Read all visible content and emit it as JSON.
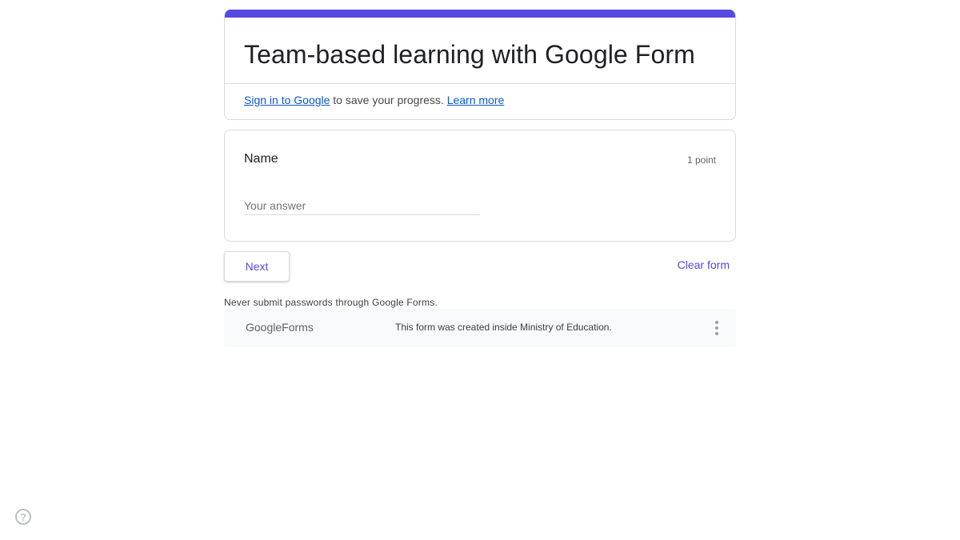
{
  "colors": {
    "accent": "#5748e2",
    "link": "#0b57d0"
  },
  "header": {
    "title": "Team-based learning with Google Form",
    "signin_link": "Sign in to Google",
    "signin_middle": " to save your progress. ",
    "learn_more": "Learn more"
  },
  "question": {
    "title": "Name",
    "points": "1 point",
    "placeholder": "Your answer",
    "value": ""
  },
  "actions": {
    "next_label": "Next",
    "clear_label": "Clear form"
  },
  "warning": "Never submit passwords through Google Forms.",
  "footer": {
    "logo_google": "Google",
    "logo_forms": "Forms",
    "text": "This form was created inside Ministry of Education.",
    "menu_icon": "more-vert-icon"
  },
  "help": {
    "icon": "help-icon",
    "glyph": "?"
  }
}
